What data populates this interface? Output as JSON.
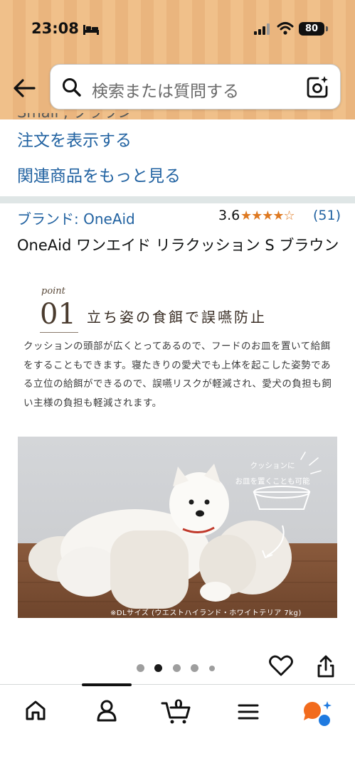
{
  "status_bar": {
    "time": "23:08",
    "battery": "80"
  },
  "search": {
    "placeholder": "検索または質問する"
  },
  "order_section": {
    "cut_text": "Small , ブラウン",
    "view_order_link": "注文を表示する",
    "related_link": "関連商品をもっと見る"
  },
  "product": {
    "brand": "ブランド: OneAid",
    "rating": "3.6",
    "stars": "★★★★☆",
    "rating_count": "(51)",
    "title": "OneAid ワンエイド リラクッション S ブラウン"
  },
  "feature": {
    "point_label": "point",
    "point_number": "01",
    "heading": "立ち姿の食餌で誤嚥防止",
    "body": "クッションの頭部が広くとってあるので、フードのお皿を置いて給餌をすることもできます。寝たきりの愛犬でも上体を起こした姿勢である立位の給餌ができるので、誤嚥リスクが軽減され、愛犬の負担も飼い主様の負担も軽減されます。",
    "photo_caption": "クッションに\nお皿を置くことも可能",
    "photo_footnote": "※DLサイズ (ウエストハイランド・ホワイトテリア 7kg)"
  },
  "carousel": {
    "total": 5,
    "active_index": 1
  },
  "bottom_nav": {
    "cart_count": "0",
    "items": [
      "home-icon",
      "account-icon",
      "cart-icon",
      "menu-icon",
      "assistant-icon"
    ]
  },
  "colors": {
    "link": "#2162a1",
    "star": "#de7921",
    "header_bg": "#f0c08a"
  }
}
